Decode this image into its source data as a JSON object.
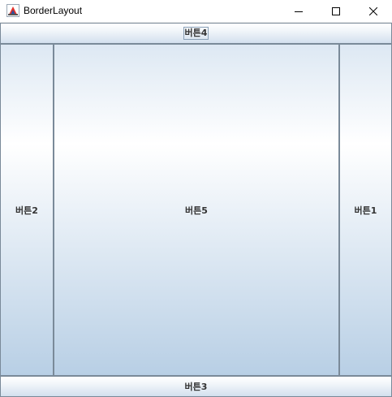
{
  "window": {
    "title": "BorderLayout",
    "icon": "java-coffee-cup-icon",
    "controls": [
      "minimize-icon",
      "maximize-icon",
      "close-icon"
    ]
  },
  "buttons": {
    "north": "버튼4",
    "west": "버튼2",
    "center": "버튼5",
    "east": "버튼1",
    "south": "버튼3"
  },
  "colors": {
    "button_border": "#7a8a99",
    "button_gradient_top": "#ffffff",
    "button_gradient_bottom": "#b8cfe5",
    "text": "#333333"
  }
}
